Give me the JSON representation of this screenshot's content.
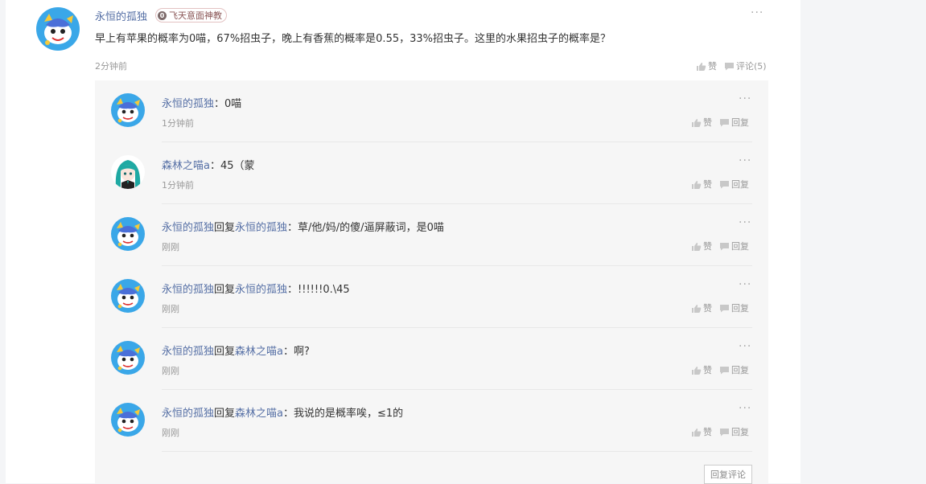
{
  "comment": {
    "username": "永恒的孤独",
    "badge": {
      "level": "0",
      "name": "飞天意面神教"
    },
    "text": "早上有苹果的概率为0喵，67%招虫子，晚上有香蕉的概率是0.55，33%招虫子。这里的水果招虫子的概率是？",
    "time": "2分钟前",
    "more": "···",
    "like_label": "赞",
    "comment_label": "评论(5)",
    "avatar_icon": "blue-cartoon-avatar"
  },
  "replies": [
    {
      "username": "永恒的孤独",
      "reply_word": "",
      "target": "",
      "text": "：0喵",
      "time": "1分钟前",
      "avatar_icon": "blue-cartoon-avatar"
    },
    {
      "username": "森林之喵a",
      "reply_word": "",
      "target": "",
      "text": "：45（蒙",
      "time": "1分钟前",
      "avatar_icon": "teal-hair-girl-avatar"
    },
    {
      "username": "永恒的孤独",
      "reply_word": "回复",
      "target": "永恒的孤独",
      "text": "：草/他/妈/的傻/逼屏蔽词，是0喵",
      "time": "刚刚",
      "avatar_icon": "blue-cartoon-avatar"
    },
    {
      "username": "永恒的孤独",
      "reply_word": "回复",
      "target": "永恒的孤独",
      "text": "：!!!!!!0.\\45",
      "time": "刚刚",
      "avatar_icon": "blue-cartoon-avatar"
    },
    {
      "username": "永恒的孤独",
      "reply_word": "回复",
      "target": "森林之喵a",
      "text": "：啊?",
      "time": "刚刚",
      "avatar_icon": "blue-cartoon-avatar"
    },
    {
      "username": "永恒的孤独",
      "reply_word": "回复",
      "target": "森林之喵a",
      "text": "：我说的是概率唉，≤1的",
      "time": "刚刚",
      "avatar_icon": "blue-cartoon-avatar"
    }
  ],
  "reply_actions": {
    "like_label": "赞",
    "reply_label": "回复",
    "more": "···"
  },
  "reply_comment_button": "回复评论",
  "colors": {
    "username": "#556fa5",
    "muted": "#999999",
    "reply_bg": "#f6f6f6"
  }
}
